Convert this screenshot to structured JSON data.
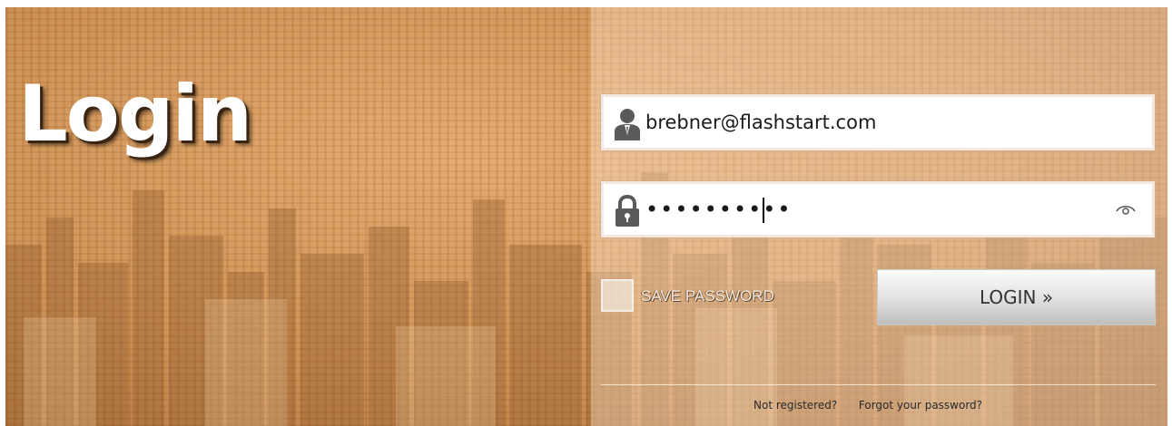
{
  "title": "Login",
  "form": {
    "email_value": "brebner@flashstart.com",
    "email_icon": "user-icon",
    "password_value": "••••••••••",
    "password_icon": "lock-icon",
    "show_password_icon": "eye-icon",
    "save_password_label": "SAVE PASSWORD",
    "save_password_checked": false,
    "login_label": "LOGIN »"
  },
  "footer": {
    "not_registered": "Not registered?",
    "forgot_password": "Forgot your password?"
  },
  "colors": {
    "background_tint": "#d2955a",
    "field_bg": "#ffffff",
    "button_gradient_top": "#fbfbfb",
    "button_gradient_bottom": "#bfbfbf"
  }
}
